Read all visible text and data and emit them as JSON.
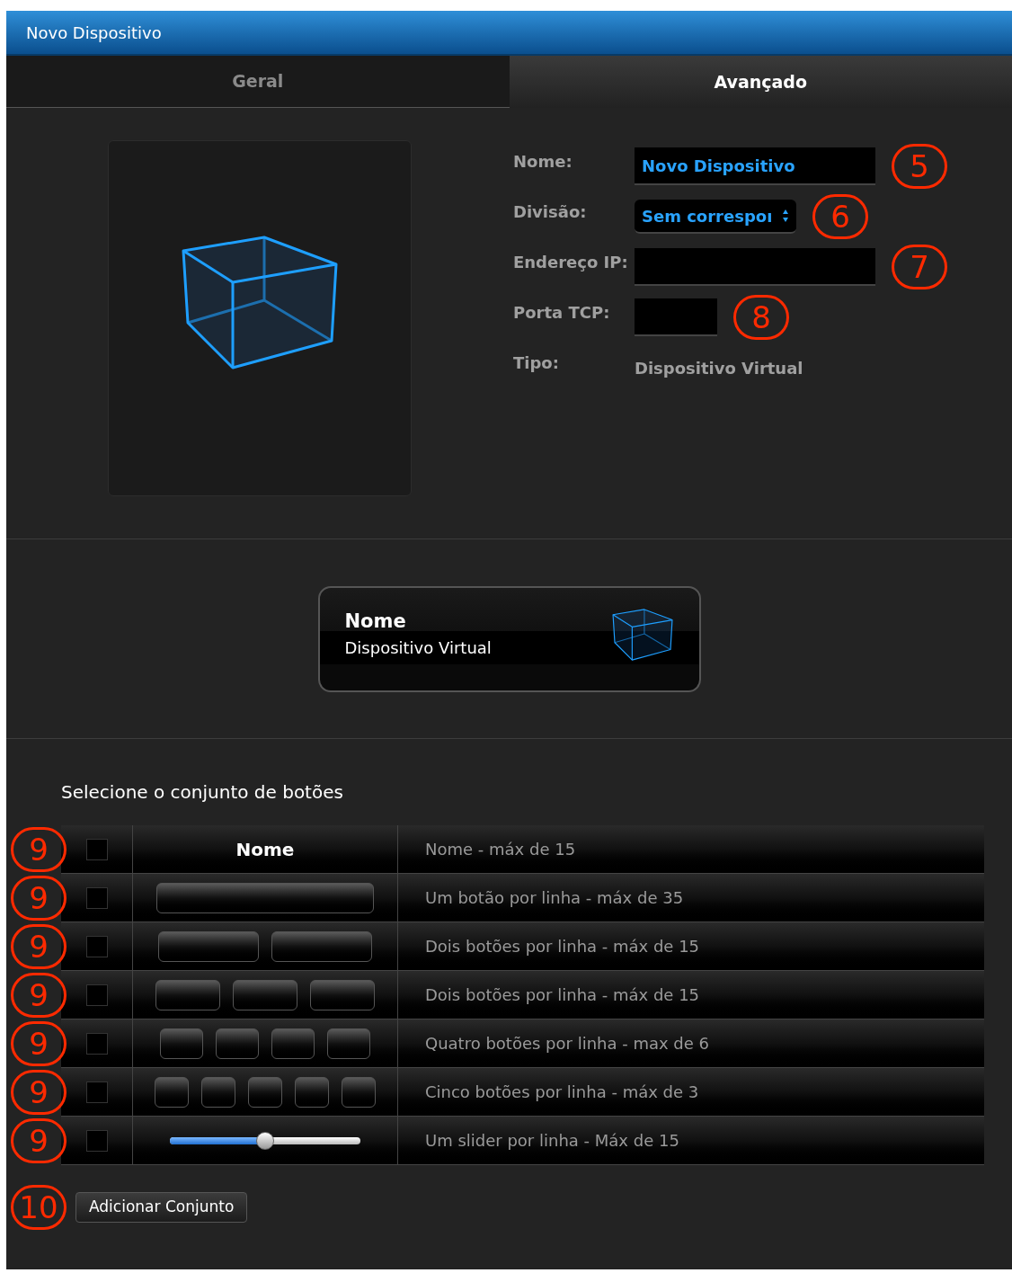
{
  "window": {
    "title": "Novo Dispositivo"
  },
  "tabs": [
    {
      "label": "Geral",
      "selected": false
    },
    {
      "label": "Avançado",
      "selected": true
    }
  ],
  "form": {
    "fields": [
      {
        "label": "Nome:",
        "kind": "text",
        "value": "Novo Dispositivo",
        "callout": "5"
      },
      {
        "label": "Divisão:",
        "kind": "select",
        "value": "Sem correspoı",
        "callout": "6"
      },
      {
        "label": "Endereço IP:",
        "kind": "text",
        "callout": "7"
      },
      {
        "label": "Porta TCP:",
        "kind": "short",
        "callout": "8"
      },
      {
        "label": "Tipo:",
        "kind": "static",
        "value": "Dispositivo Virtual"
      }
    ]
  },
  "preview_card": {
    "title": "Nome",
    "subtitle": "Dispositivo Virtual"
  },
  "button_sets": {
    "heading": "Selecione o conjunto de botões",
    "rows": [
      {
        "kind": "label",
        "label": "Nome",
        "description": "Nome - máx de 15",
        "checked": false,
        "callout": "9"
      },
      {
        "kind": "one",
        "description": "Um botão por linha - máx de 35",
        "checked": false,
        "callout": "9"
      },
      {
        "kind": "two",
        "description": "Dois botões por linha - máx de 15",
        "checked": false,
        "callout": "9"
      },
      {
        "kind": "three",
        "description": "Dois botões por linha - máx de 15",
        "checked": false,
        "callout": "9"
      },
      {
        "kind": "four",
        "description": "Quatro botões por linha - max de 6",
        "checked": false,
        "callout": "9"
      },
      {
        "kind": "five",
        "description": "Cinco botões por linha - máx de 3",
        "checked": false,
        "callout": "9"
      },
      {
        "kind": "slider",
        "level": 0.5,
        "description": "Um slider por linha - Máx de 15",
        "checked": false,
        "callout": "9"
      }
    ]
  },
  "add_button": {
    "label": "Adicionar Conjunto",
    "callout": "10"
  }
}
